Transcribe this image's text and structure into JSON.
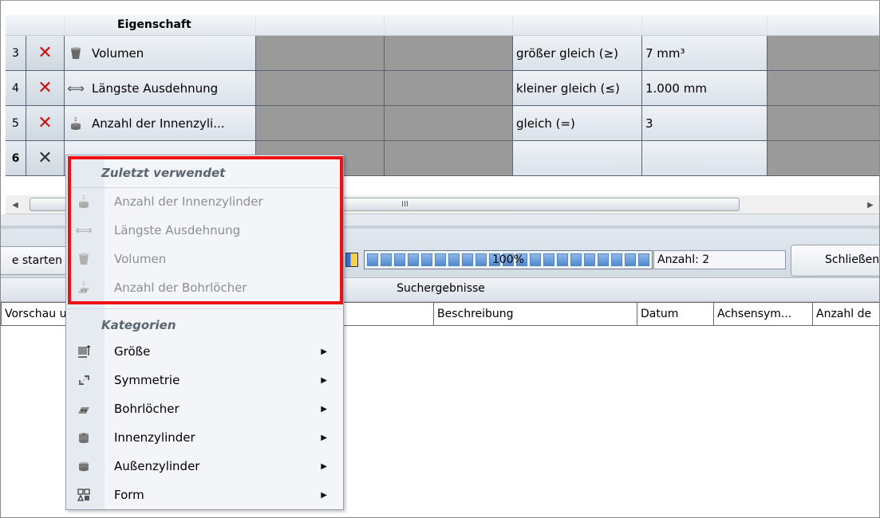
{
  "grid": {
    "header": {
      "property": "Eigenschaft"
    },
    "rows": [
      {
        "num": "3",
        "icon": "cylinder-cup-icon",
        "property": "Volumen",
        "operator": "größer gleich (≥)",
        "value": "7 mm³"
      },
      {
        "num": "4",
        "icon": "double-arrow-icon",
        "property": "Längste Ausdehnung",
        "operator": "kleiner gleich (≤)",
        "value": "1.000 mm"
      },
      {
        "num": "5",
        "icon": "inner-cylinder-icon",
        "property": "Anzahl der Innenzyli...",
        "operator": "gleich (=)",
        "value": "3"
      },
      {
        "num": "6",
        "icon": "",
        "property": "",
        "operator": "",
        "value": ""
      }
    ],
    "scroll_grip": "III"
  },
  "actions": {
    "start_label": "e starten",
    "progress_text": "100%",
    "progress": 1.0,
    "count_label": "Anzahl: 2",
    "close_label": "Schließen"
  },
  "results": {
    "title": "Suchergebnisse",
    "columns": [
      "Vorschau u",
      "",
      "Beschreibung",
      "Datum",
      "Achsensym...",
      "Anzahl de"
    ]
  },
  "menu": {
    "recent_title": "Zuletzt verwendet",
    "recent": [
      {
        "label": "Anzahl der Innenzylinder",
        "icon": "inner-cylinder-icon"
      },
      {
        "label": "Längste Ausdehnung",
        "icon": "double-arrow-icon"
      },
      {
        "label": "Volumen",
        "icon": "cylinder-cup-icon"
      },
      {
        "label": "Anzahl der Bohrlöcher",
        "icon": "drill-holes-icon"
      }
    ],
    "categories_title": "Kategorien",
    "categories": [
      {
        "label": "Größe",
        "icon": "size-icon"
      },
      {
        "label": "Symmetrie",
        "icon": "symmetry-icon"
      },
      {
        "label": "Bohrlöcher",
        "icon": "drill-holes-icon"
      },
      {
        "label": "Innenzylinder",
        "icon": "inner-cylinder-icon"
      },
      {
        "label": "Außenzylinder",
        "icon": "outer-cylinder-icon"
      },
      {
        "label": "Form",
        "icon": "shapes-icon"
      }
    ]
  },
  "colors": {
    "highlight": "#ee1111",
    "delete": "#cc1111",
    "disabled_text": "#8a8f96"
  }
}
